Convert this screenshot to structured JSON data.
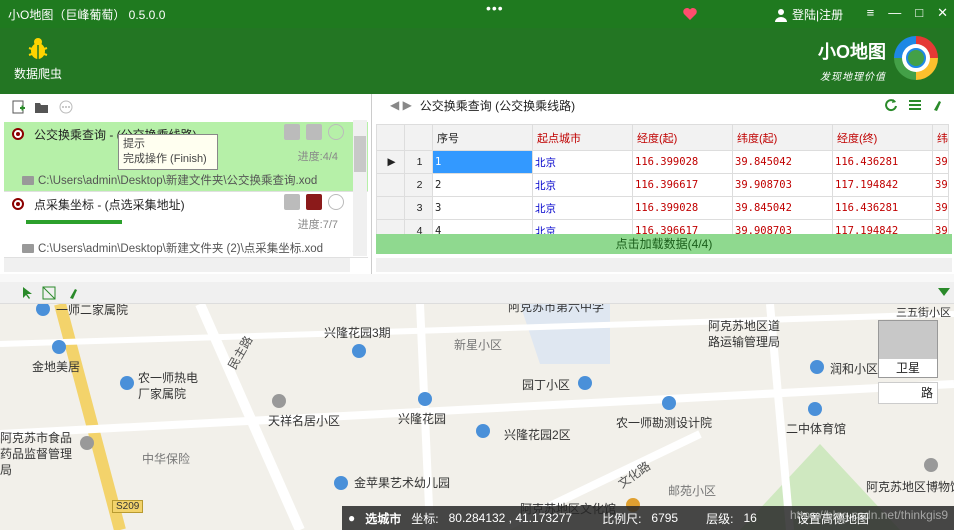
{
  "window": {
    "title": "小O地图（巨峰葡萄） 0.5.0.0",
    "menu_dots": "•••",
    "user_label": "登陆|注册",
    "win_buttons": [
      "≡",
      "—",
      "□",
      "✕"
    ]
  },
  "header": {
    "crawler_label": "数据爬虫",
    "brand_name": "小O地图",
    "brand_tagline": "发现地理价值"
  },
  "tasks": [
    {
      "name": "公交换乘查询 - (公交换乘线路)",
      "progress": "进度:4/4",
      "path": "C:\\Users\\admin\\Desktop\\新建文件夹\\公交换乘查询.xod"
    },
    {
      "name": "点采集坐标 - (点选采集地址)",
      "progress": "进度:7/7",
      "path": "C:\\Users\\admin\\Desktop\\新建文件夹 (2)\\点采集坐标.xod"
    }
  ],
  "tooltip": {
    "title": "提示",
    "body": "完成操作 (Finish)"
  },
  "right_panel": {
    "title": "公交换乘查询 (公交换乘线路)",
    "load_label": "点击加载数据(4/4)"
  },
  "table": {
    "headers": [
      "序号",
      "起点城市",
      "经度(起)",
      "纬度(起)",
      "经度(终)",
      "纬"
    ],
    "rows": [
      {
        "n": "1",
        "seq": "1",
        "city": "北京",
        "lng1": "116.399028",
        "lat1": "39.845042",
        "lng2": "116.436281",
        "lat2": "39"
      },
      {
        "n": "2",
        "seq": "2",
        "city": "北京",
        "lng1": "116.396617",
        "lat1": "39.908703",
        "lng2": "117.194842",
        "lat2": "39"
      },
      {
        "n": "3",
        "seq": "3",
        "city": "北京",
        "lng1": "116.399028",
        "lat1": "39.845042",
        "lng2": "116.436281",
        "lat2": "39"
      },
      {
        "n": "4",
        "seq": "4",
        "city": "北京",
        "lng1": "116.396617",
        "lat1": "39.908703",
        "lng2": "117.194842",
        "lat2": "39"
      }
    ]
  },
  "map": {
    "labels": {
      "p1": "一师二家属院",
      "p2": "阿克苏市第六中学",
      "p3": "兴隆花园3期",
      "p4": "三五街小区",
      "p5": "新星小区",
      "p6": "阿克苏地区道路运输管理局",
      "p7": "金地美居",
      "p8": "民主路",
      "p9": "农一师热电厂家属院",
      "p10": "园丁小区",
      "p11": "润和小区",
      "p12": "天祥名居小区",
      "p13": "兴隆花园",
      "p14": "农一师勘测设计院",
      "p15": "阿克苏市食品药品监督管理局",
      "p16": "兴隆花园2区",
      "p17": "二中体育馆",
      "p18": "中华保险",
      "p19": "金苹果艺术幼儿园",
      "p20": "文化路",
      "p21": "邮苑小区",
      "p22": "阿克苏地区博物馆",
      "p23": "阿克苏地区文化馆",
      "p24": "S209"
    },
    "satellite_label": "卫星",
    "road_label": "路"
  },
  "status": {
    "select_city": "选城市",
    "coord_label": "坐标:",
    "coord_value": "80.284132 , 41.173277",
    "scale_label": "比例尺:",
    "scale_value": "6795",
    "level_label": "层级:",
    "level_value": "16",
    "hd_map": "设置高德地图"
  },
  "watermark": "https://blog.csdn.net/thinkgis9",
  "colors": {
    "titlebar": "#1f7a1f",
    "header": "#237623",
    "selected_task": "#b6f0a8",
    "load_bar": "#8fd98f",
    "header_red": "#c00000",
    "city_blue": "#0000cc"
  }
}
